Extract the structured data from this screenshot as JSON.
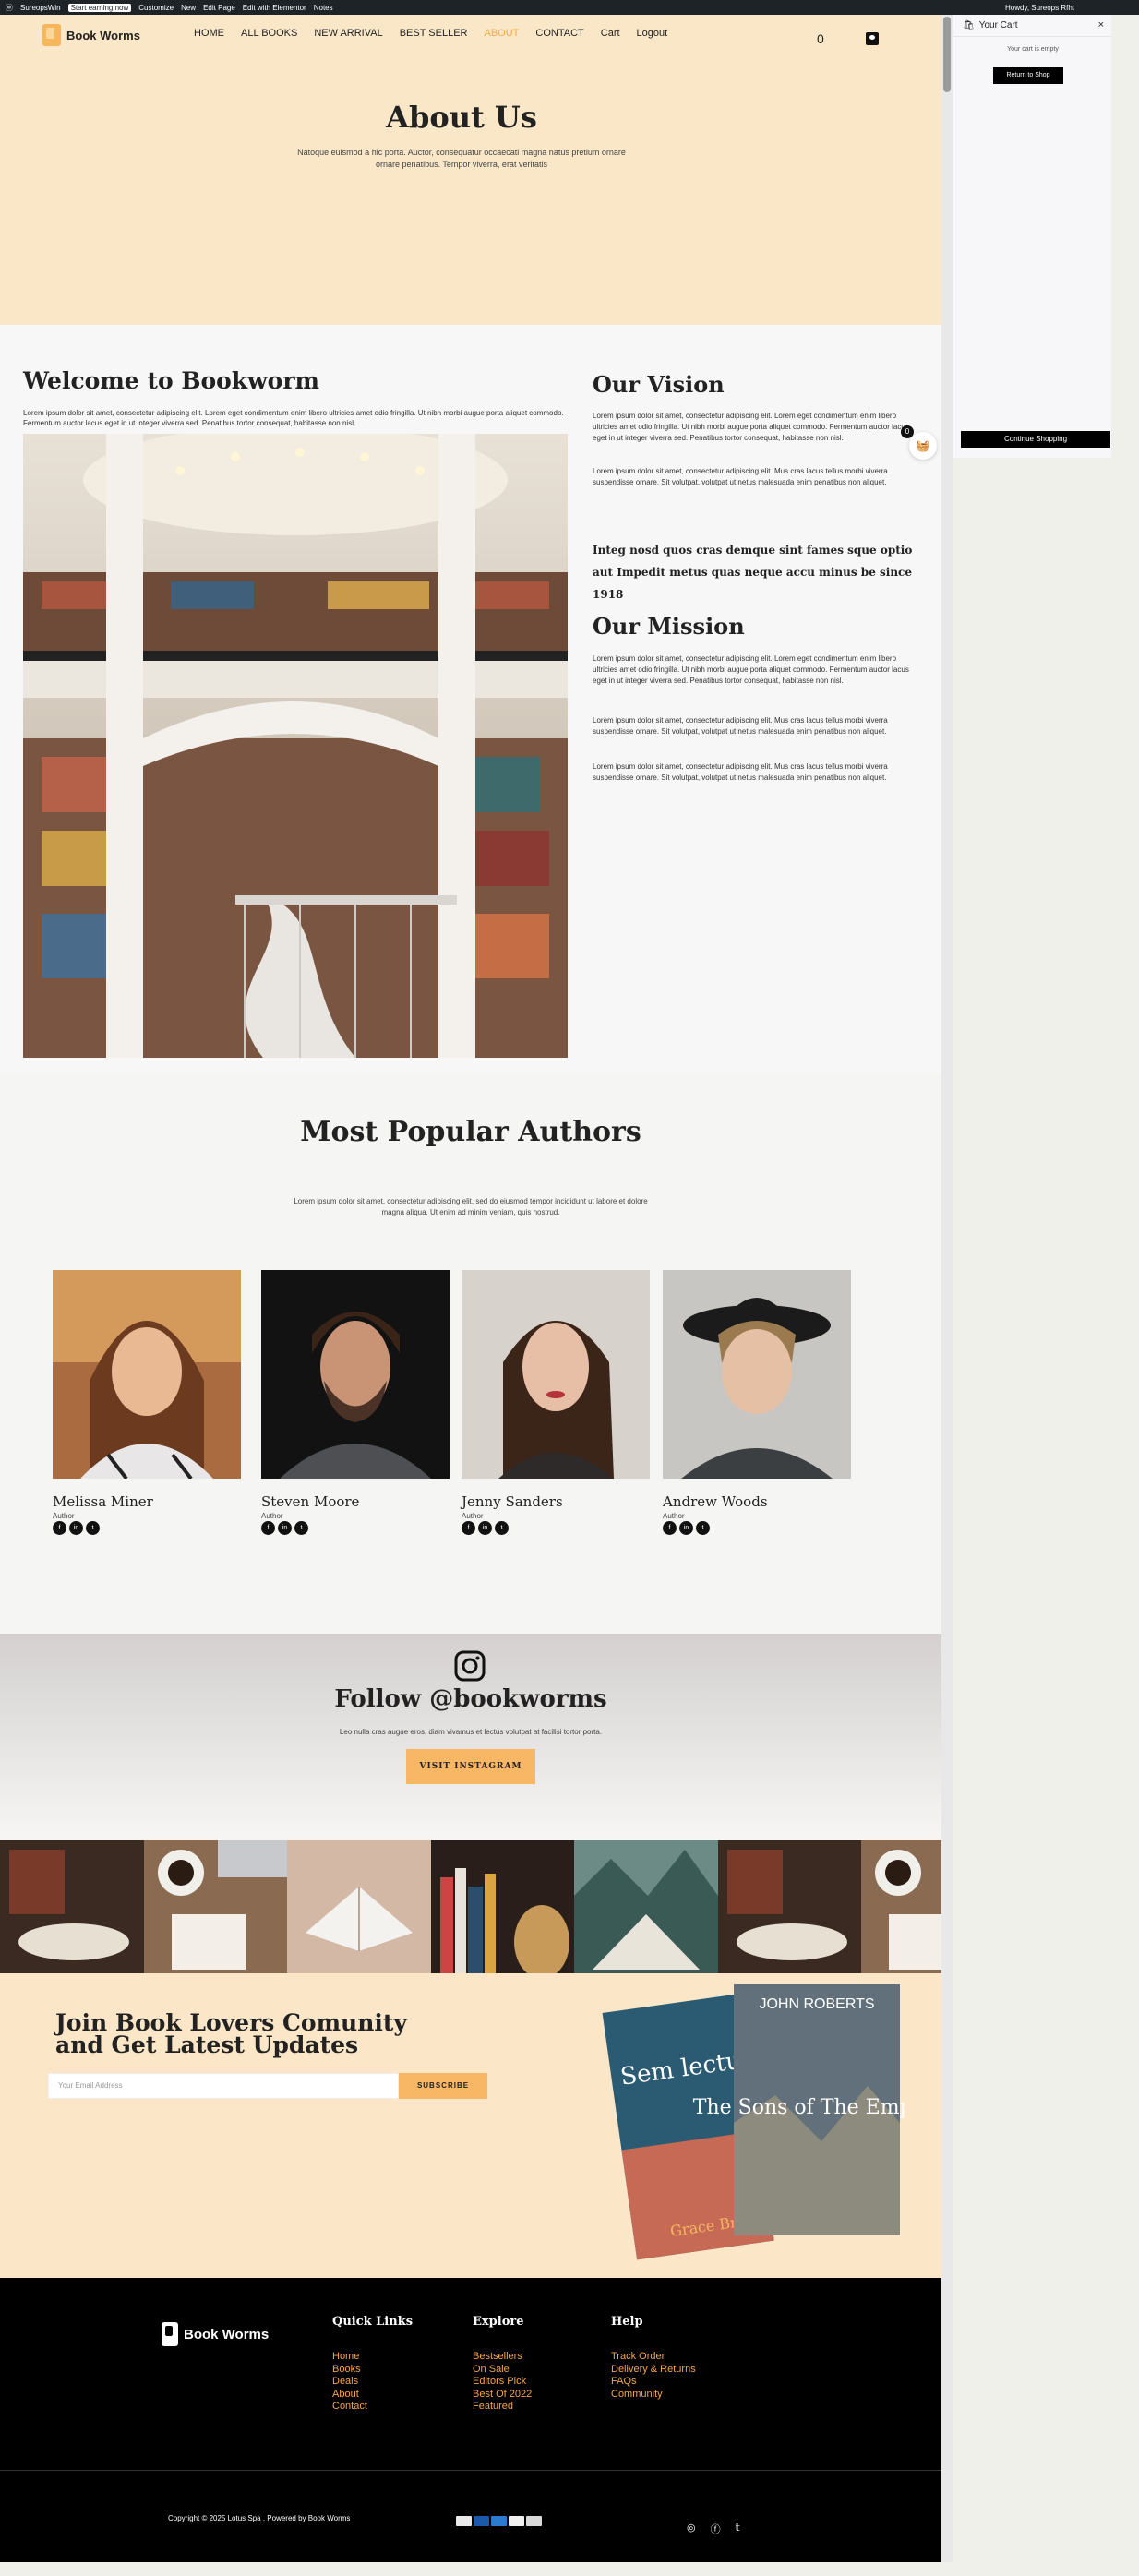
{
  "adminbar": {
    "site": "SureopsWin",
    "tag": "Start earning now",
    "items": [
      "Customize",
      "New",
      "Edit Page",
      "Edit with Elementor",
      "Notes"
    ],
    "user": "Howdy, Sureops Rfht"
  },
  "header": {
    "logo": "Book Worms",
    "nav": [
      "HOME",
      "ALL BOOKS",
      "NEW ARRIVAL",
      "BEST SELLER",
      "ABOUT",
      "CONTACT",
      "Cart",
      "Logout"
    ],
    "active": "ABOUT",
    "cart_count": "0"
  },
  "about": {
    "title": "About Us",
    "subtitle": "Natoque euismod a hic porta. Auctor, consequatur occaecati magna natus pretium ornare ornare penatibus. Tempor viverra, erat veritatis"
  },
  "welcome": {
    "title": "Welcome to Bookworm",
    "text": "Lorem ipsum dolor sit amet, consectetur adipiscing elit. Lorem eget condimentum enim libero ultricies amet odio fringilla. Ut nibh morbi augue porta aliquet commodo. Fermentum auctor lacus eget in ut integer viverra sed. Penatibus tortor consequat, habitasse non nisl."
  },
  "vision": {
    "title": "Our Vision",
    "p1": "Lorem ipsum dolor sit amet, consectetur adipiscing elit. Lorem eget condimentum enim libero ultricies amet odio fringilla. Ut nibh morbi augue porta aliquet commodo. Fermentum auctor lacus eget in ut integer viverra sed. Penatibus tortor consequat, habitasse non nisl.",
    "p2": "Lorem ipsum dolor sit amet, consectetur adipiscing elit. Mus cras lacus tellus morbi viverra suspendisse ornare. Sit volutpat, volutpat ut netus malesuada enim penatibus non aliquet.",
    "quote": "Integ nosd quos cras demque sint fames sque optio aut Impedit metus quas neque accu minus be since 1918"
  },
  "mission": {
    "title": "Our Mission",
    "p1": "Lorem ipsum dolor sit amet, consectetur adipiscing elit. Lorem eget condimentum enim libero ultricies amet odio fringilla. Ut nibh morbi augue porta aliquet commodo. Fermentum auctor lacus eget in ut integer viverra sed. Penatibus tortor consequat, habitasse non nisl.",
    "p2": "Lorem ipsum dolor sit amet, consectetur adipiscing elit. Mus cras lacus tellus morbi viverra suspendisse ornare. Sit volutpat, volutpat ut netus malesuada enim penatibus non aliquet.",
    "p3": "Lorem ipsum dolor sit amet, consectetur adipiscing elit. Mus cras lacus tellus morbi viverra suspendisse ornare. Sit volutpat, volutpat ut netus malesuada enim penatibus non aliquet."
  },
  "floating_cart": {
    "count": "0"
  },
  "authors": {
    "title": "Most Popular Authors",
    "subtitle": "Lorem ipsum dolor sit amet, consectetur adipiscing elit, sed do eiusmod tempor incididunt ut labore et dolore magna aliqua. Ut enim ad minim veniam, quis nostrud.",
    "list": [
      {
        "name": "Melissa Miner",
        "role": "Author"
      },
      {
        "name": "Steven Moore",
        "role": "Author"
      },
      {
        "name": "Jenny Sanders",
        "role": "Author"
      },
      {
        "name": "Andrew Woods",
        "role": "Author"
      }
    ]
  },
  "instagram": {
    "title": "Follow @bookworms",
    "subtitle": "Leo nulla cras augue eros, diam vivamus et lectus volutpat at facilisi tortor porta.",
    "button": "VISIT INSTAGRAM"
  },
  "newsletter": {
    "title": "Join Book Lovers Comunity and Get Latest Updates",
    "placeholder": "Your Email Address",
    "button": "SUBSCRIBE",
    "book1_title": "Sem lectu",
    "book1_author": "Grace Bry",
    "book2_author": "JOHN ROBERTS",
    "book2_title": "The Sons of The Empire"
  },
  "footer": {
    "logo": "Book Worms",
    "cols": [
      {
        "title": "Quick Links",
        "links": [
          "Home",
          "Books",
          "Deals",
          "About",
          "Contact"
        ]
      },
      {
        "title": "Explore",
        "links": [
          "Bestsellers",
          "On Sale",
          "Editors Pick",
          "Best Of 2022",
          "Featured"
        ]
      },
      {
        "title": "Help",
        "links": [
          "Track Order",
          "Delivery & Returns",
          "FAQs",
          "Community"
        ]
      }
    ],
    "copyright": "Copyright © 2025 Lotus Spa . Powered by Book Worms"
  },
  "cart_panel": {
    "title": "Your Cart",
    "empty": "Your cart is empty",
    "return": "Return to Shop",
    "continue": "Continue Shopping"
  },
  "colors": {
    "accent": "#f7b765",
    "hero_bg": "#f9e7c8",
    "footer_bg": "#000000"
  }
}
